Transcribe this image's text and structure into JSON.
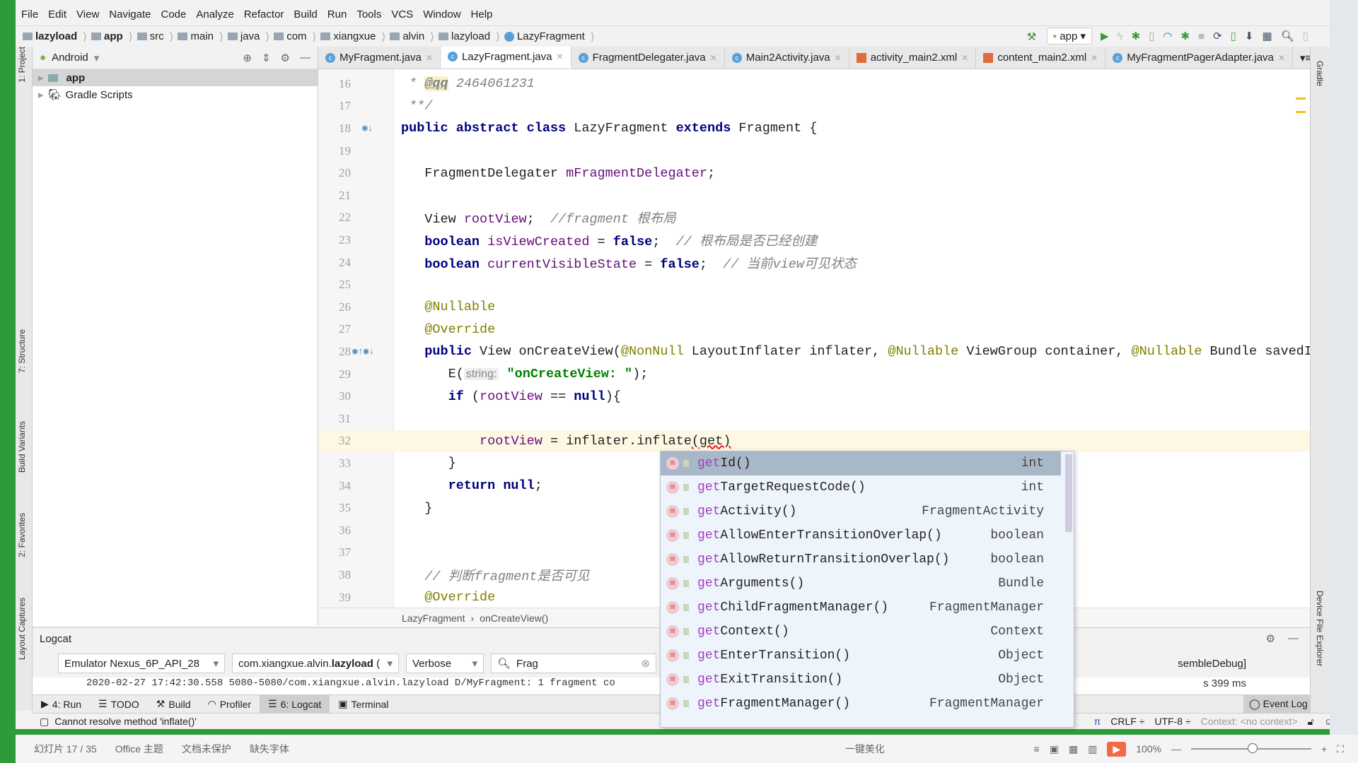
{
  "menu": [
    "File",
    "Edit",
    "View",
    "Navigate",
    "Code",
    "Analyze",
    "Refactor",
    "Build",
    "Run",
    "Tools",
    "VCS",
    "Window",
    "Help"
  ],
  "breadcrumb": [
    "lazyload",
    "app",
    "src",
    "main",
    "java",
    "com",
    "xiangxue",
    "alvin",
    "lazyload",
    "LazyFragment"
  ],
  "run_config": "app",
  "project": {
    "view": "Android",
    "items": [
      "app",
      "Gradle Scripts"
    ]
  },
  "left_tool_windows": [
    "1: Project",
    "7: Structure",
    "Build Variants",
    "2: Favorites",
    "Layout Captures"
  ],
  "right_tool_windows": [
    "Gradle",
    "Device File Explorer"
  ],
  "tabs": [
    {
      "label": "MyFragment.java",
      "type": "class"
    },
    {
      "label": "LazyFragment.java",
      "type": "class",
      "active": true
    },
    {
      "label": "FragmentDelegater.java",
      "type": "class"
    },
    {
      "label": "Main2Activity.java",
      "type": "class"
    },
    {
      "label": "activity_main2.xml",
      "type": "xml"
    },
    {
      "label": "content_main2.xml",
      "type": "xml"
    },
    {
      "label": "MyFragmentPagerAdapter.java",
      "type": "class"
    }
  ],
  "tabs_overflow": "▾≡1",
  "code": [
    {
      "n": "16",
      "tokens": [
        {
          "t": " * ",
          "c": "cm"
        },
        {
          "t": "@qq",
          "c": "tag"
        },
        {
          "t": " 2464061231",
          "c": "cm"
        }
      ]
    },
    {
      "n": "17",
      "tokens": [
        {
          "t": " **/",
          "c": "cm"
        }
      ]
    },
    {
      "n": "18",
      "tokens": [
        {
          "t": "public abstract class ",
          "c": "kw"
        },
        {
          "t": "LazyFragment ",
          "c": ""
        },
        {
          "t": "extends ",
          "c": "kw"
        },
        {
          "t": "Fragment {",
          "c": ""
        }
      ]
    },
    {
      "n": "19",
      "tokens": []
    },
    {
      "n": "20",
      "tokens": [
        {
          "t": "   FragmentDelegater ",
          "c": ""
        },
        {
          "t": "mFragmentDelegater",
          "c": "fld"
        },
        {
          "t": ";",
          "c": ""
        }
      ]
    },
    {
      "n": "21",
      "tokens": []
    },
    {
      "n": "22",
      "tokens": [
        {
          "t": "   View ",
          "c": ""
        },
        {
          "t": "rootView",
          "c": "fld"
        },
        {
          "t": ";  ",
          "c": ""
        },
        {
          "t": "//fragment 根布局",
          "c": "cm"
        }
      ]
    },
    {
      "n": "23",
      "tokens": [
        {
          "t": "   boolean ",
          "c": "kw"
        },
        {
          "t": "isViewCreated",
          "c": "fld"
        },
        {
          "t": " = ",
          "c": ""
        },
        {
          "t": "false",
          "c": "kw"
        },
        {
          "t": ";  ",
          "c": ""
        },
        {
          "t": "// 根布局是否已经创建",
          "c": "cm"
        }
      ]
    },
    {
      "n": "24",
      "tokens": [
        {
          "t": "   boolean ",
          "c": "kw"
        },
        {
          "t": "currentVisibleState",
          "c": "fld"
        },
        {
          "t": " = ",
          "c": ""
        },
        {
          "t": "false",
          "c": "kw"
        },
        {
          "t": ";  ",
          "c": ""
        },
        {
          "t": "// 当前view可见状态",
          "c": "cm"
        }
      ]
    },
    {
      "n": "25",
      "tokens": []
    },
    {
      "n": "26",
      "tokens": [
        {
          "t": "   @Nullable",
          "c": "ann"
        }
      ]
    },
    {
      "n": "27",
      "tokens": [
        {
          "t": "   @Override",
          "c": "ann"
        }
      ]
    },
    {
      "n": "28",
      "tokens": [
        {
          "t": "   public ",
          "c": "kw"
        },
        {
          "t": "View onCreateView(",
          "c": ""
        },
        {
          "t": "@NonNull ",
          "c": "ann"
        },
        {
          "t": "LayoutInflater inflater, ",
          "c": ""
        },
        {
          "t": "@Nullable ",
          "c": "ann"
        },
        {
          "t": "ViewGroup container, ",
          "c": ""
        },
        {
          "t": "@Nullable ",
          "c": "ann"
        },
        {
          "t": "Bundle savedInstance",
          "c": ""
        }
      ]
    },
    {
      "n": "29",
      "tokens": [
        {
          "t": "      E(",
          "c": ""
        },
        {
          "t": "string:",
          "c": "hint"
        },
        {
          "t": " \"onCreateView: \"",
          "c": "str"
        },
        {
          "t": ");",
          "c": ""
        }
      ]
    },
    {
      "n": "30",
      "tokens": [
        {
          "t": "      if ",
          "c": "kw"
        },
        {
          "t": "(",
          "c": ""
        },
        {
          "t": "rootView",
          "c": "fld"
        },
        {
          "t": " == ",
          "c": ""
        },
        {
          "t": "null",
          "c": "kw"
        },
        {
          "t": "){",
          "c": ""
        }
      ]
    },
    {
      "n": "31",
      "tokens": []
    },
    {
      "n": "32",
      "current": true,
      "tokens": [
        {
          "t": "          ",
          "c": ""
        },
        {
          "t": "rootView",
          "c": "fld"
        },
        {
          "t": " = inflater.inflate",
          "c": ""
        },
        {
          "t": "(get)",
          "c": "err"
        }
      ]
    },
    {
      "n": "33",
      "tokens": [
        {
          "t": "      }",
          "c": ""
        }
      ]
    },
    {
      "n": "34",
      "tokens": [
        {
          "t": "      return null",
          "c": "kw"
        },
        {
          "t": ";",
          "c": ""
        }
      ]
    },
    {
      "n": "35",
      "tokens": [
        {
          "t": "   }",
          "c": ""
        }
      ]
    },
    {
      "n": "36",
      "tokens": []
    },
    {
      "n": "37",
      "tokens": []
    },
    {
      "n": "38",
      "tokens": [
        {
          "t": "   // 判断fragment是否可见",
          "c": "cm"
        }
      ]
    },
    {
      "n": "39",
      "tokens": [
        {
          "t": "   @Override",
          "c": "ann"
        }
      ]
    }
  ],
  "editor_breadcrumb": [
    "LazyFragment",
    "onCreateView()"
  ],
  "completion": {
    "prefix": "get",
    "items": [
      {
        "name": "Id()",
        "type": "int"
      },
      {
        "name": "TargetRequestCode()",
        "type": "int"
      },
      {
        "name": "Activity()",
        "type": "FragmentActivity"
      },
      {
        "name": "AllowEnterTransitionOverlap()",
        "type": "boolean"
      },
      {
        "name": "AllowReturnTransitionOverlap()",
        "type": "boolean"
      },
      {
        "name": "Arguments()",
        "type": "Bundle"
      },
      {
        "name": "ChildFragmentManager()",
        "type": "FragmentManager"
      },
      {
        "name": "Context()",
        "type": "Context"
      },
      {
        "name": "EnterTransition()",
        "type": "Object"
      },
      {
        "name": "ExitTransition()",
        "type": "Object"
      },
      {
        "name": "FragmentManager()",
        "type": "FragmentManager"
      }
    ]
  },
  "logcat": {
    "title": "Logcat",
    "device": "Emulator Nexus_6P_API_28",
    "process_prefix": "com.xiangxue.alvin.",
    "process_bold": "lazyload",
    "process_suffix": " (",
    "level": "Verbose",
    "search": "Frag",
    "log_line": "2020-02-27 17:42:30.558 5080-5080/com.xiangxue.alvin.lazyload D/MyFragment: 1 fragment co",
    "right_text": "sembleDebug]",
    "right_text2": "s 399 ms"
  },
  "tool_windows": [
    "4: Run",
    "TODO",
    "Build",
    "Profiler",
    "6: Logcat",
    "Terminal"
  ],
  "active_tool": "6: Logcat",
  "event_log": "Event Log",
  "status": {
    "message": "Cannot resolve method 'inflate()'",
    "line_sep": "CRLF ÷",
    "encoding": "UTF-8 ÷",
    "context": "Context: <no context>"
  },
  "ppt": {
    "slide": "幻灯片 17 / 35",
    "theme": "Office 主题",
    "protect": "文档未保护",
    "font": "缺失字体",
    "beautify": "一键美化",
    "zoom": "100%"
  }
}
